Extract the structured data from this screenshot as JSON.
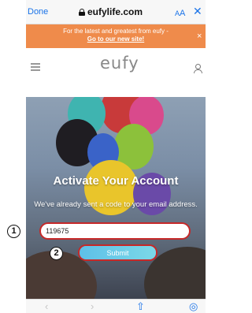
{
  "browser": {
    "done_label": "Done",
    "url": "eufylife.com",
    "text_size_small": "A",
    "text_size_large": "A",
    "close_label": "✕"
  },
  "promo": {
    "line1": "For the latest and greatest from eufy -",
    "link": "Go to our new site!",
    "close_label": "×",
    "background": "#ef8b4b"
  },
  "header": {
    "logo": "eufy"
  },
  "activation": {
    "title": "Activate Your Account",
    "subtitle": "We've already sent a code to your email address.",
    "code_value": "119675",
    "submit_label": "Submit"
  },
  "annotations": {
    "step1": "1",
    "step2": "2",
    "highlight_color": "#c62828"
  },
  "toolbar": {
    "back": "‹",
    "forward": "›",
    "share": "⇧",
    "compass": "◎"
  }
}
